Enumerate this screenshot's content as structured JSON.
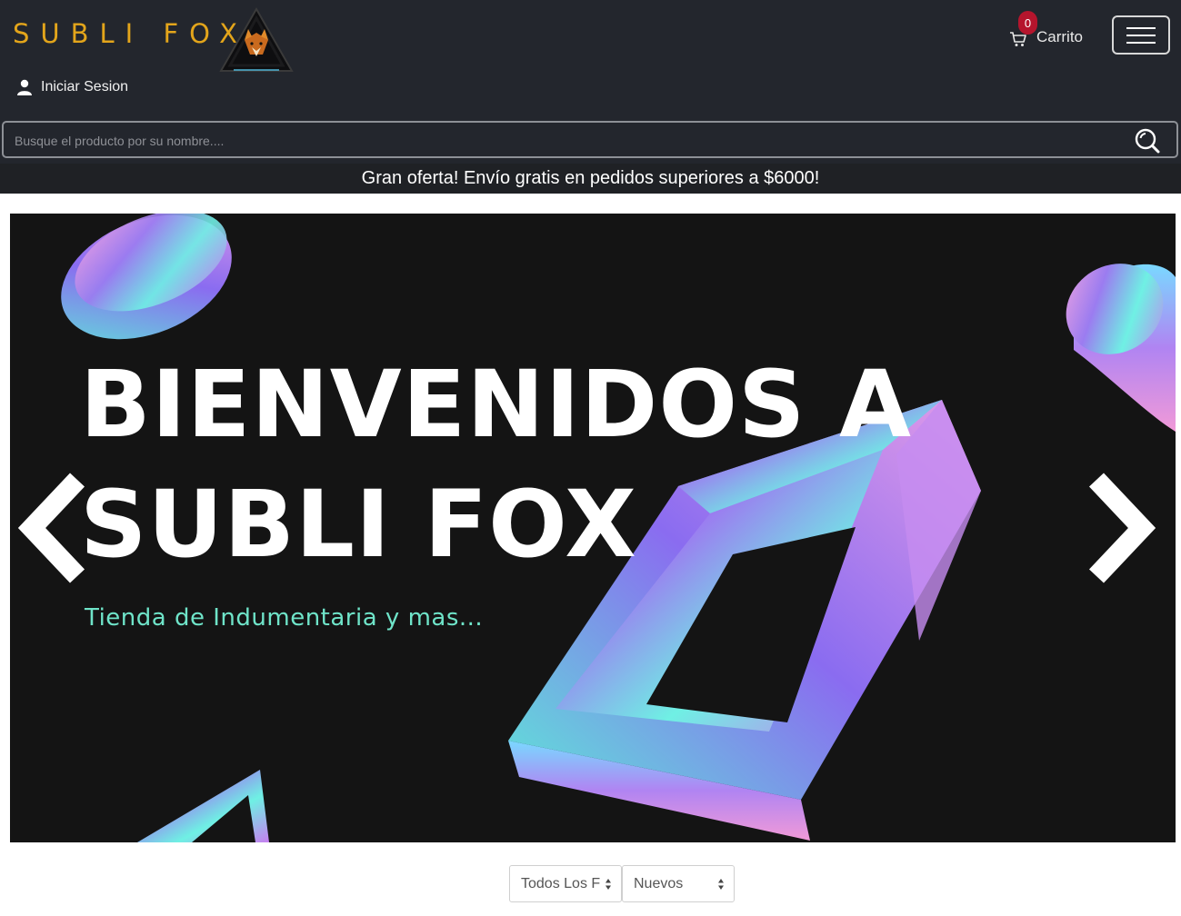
{
  "brand": {
    "name": "SUBLI FOX",
    "color": "#e3a51b",
    "logo_icon": "fox-triangle-logo"
  },
  "cart": {
    "count": "0",
    "label": "Carrito",
    "icon": "cart-icon",
    "badge_color": "#b5152d"
  },
  "menu": {
    "icon": "hamburger-icon"
  },
  "login": {
    "label": "Iniciar Sesion",
    "icon": "user-icon"
  },
  "search": {
    "placeholder": "Busque el producto por su nombre....",
    "icon": "search-icon"
  },
  "promo": {
    "text": "Gran oferta! Envío gratis en pedidos superiores a $6000!"
  },
  "hero": {
    "title_line1": "BIENVENIDOS A",
    "title_line2": "SUBLI FOX",
    "subtitle": "Tienda de Indumentaria y mas...",
    "subtitle_color": "#6fe4c9",
    "prev_icon": "chevron-left-icon",
    "next_icon": "chevron-right-icon"
  },
  "filters": {
    "category_selected": "Todos Los F",
    "sort_selected": "Nuevos"
  },
  "colors": {
    "header_bg": "#23262d",
    "promo_bg": "#1f2125",
    "hero_bg": "#141414"
  }
}
